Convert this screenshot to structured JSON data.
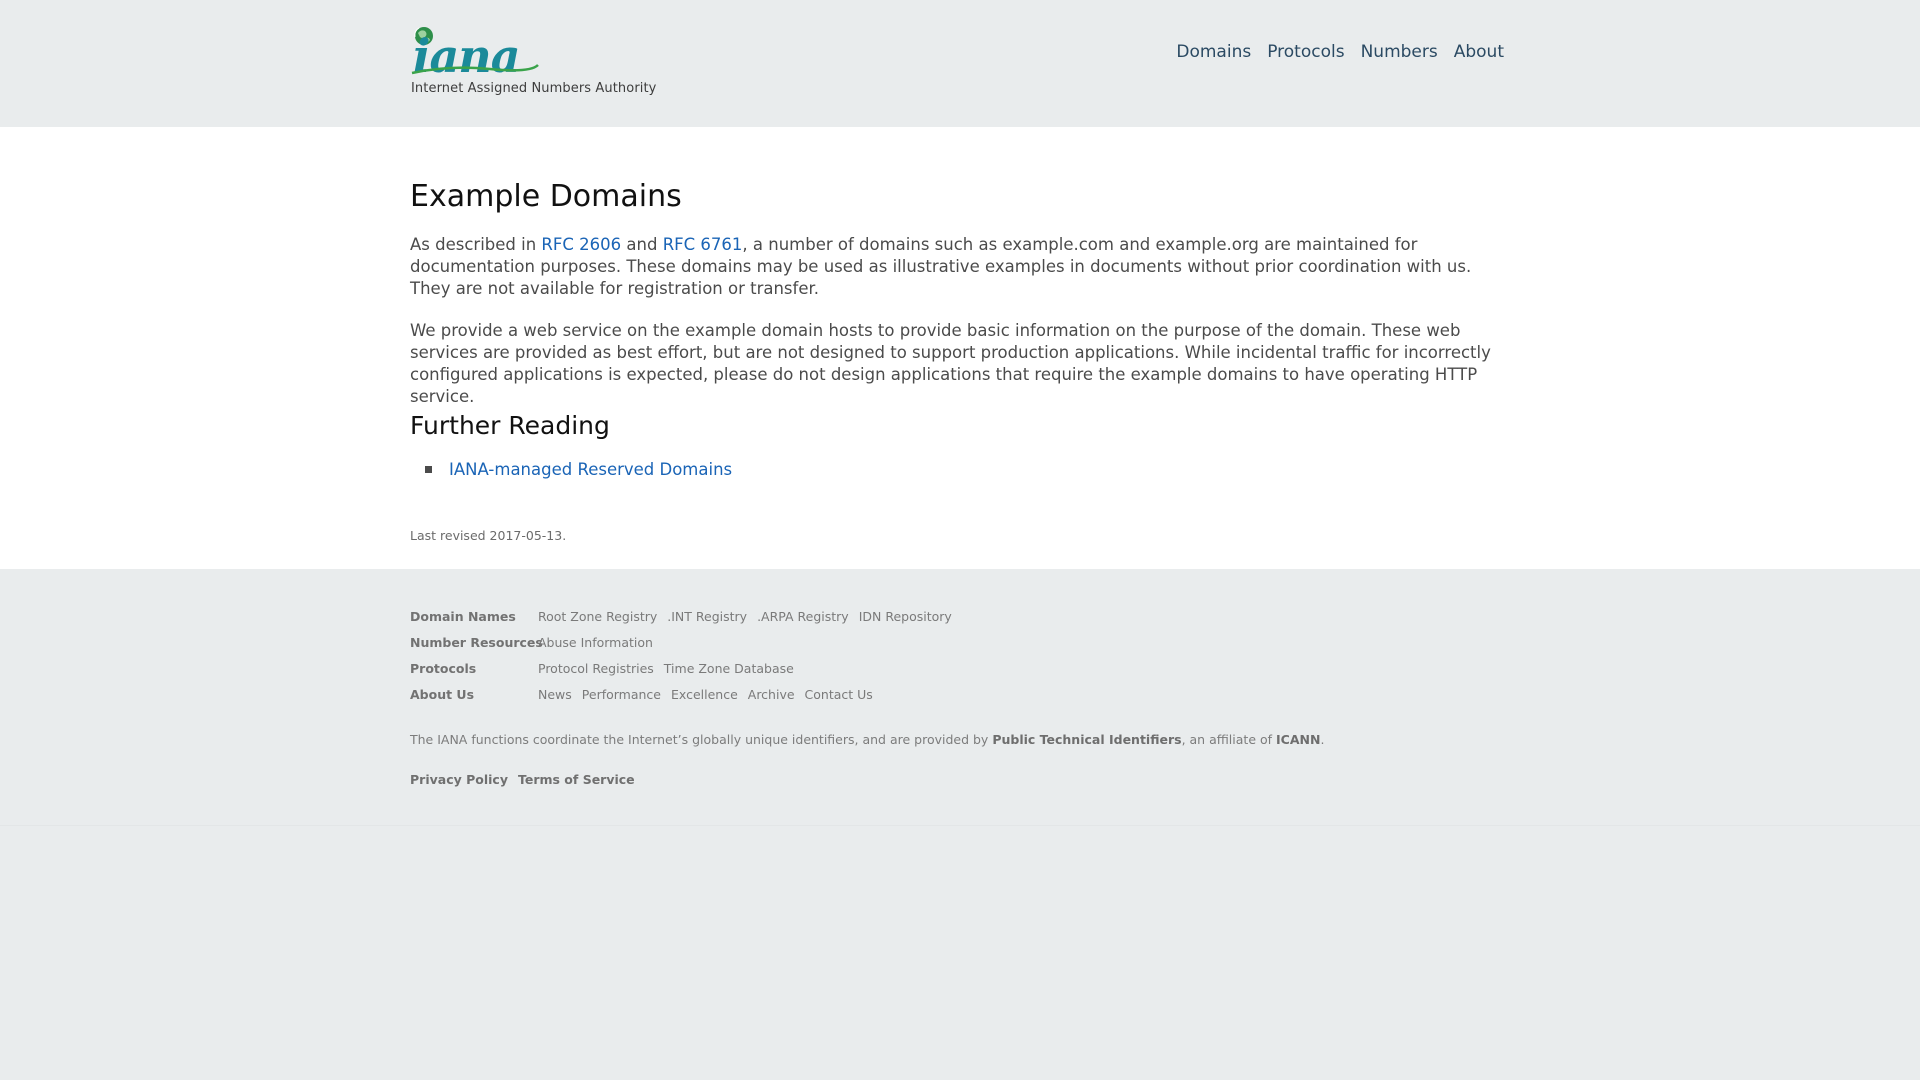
{
  "header": {
    "logo_word": "iana",
    "logo_tagline": "Internet Assigned Numbers Authority",
    "nav": [
      "Domains",
      "Protocols",
      "Numbers",
      "About"
    ]
  },
  "main": {
    "title": "Example Domains",
    "para1": {
      "t1": "As described in ",
      "link1": "RFC 2606",
      "t2": " and ",
      "link2": "RFC 6761",
      "t3": ", a number of domains such as example.com and example.org are maintained for documentation purposes. These domains may be used as illustrative examples in documents without prior coordination with us. They are not available for registration or transfer."
    },
    "para2": "We provide a web service on the example domain hosts to provide basic information on the purpose of the domain. These web services are provided as best effort, but are not designed to support production applications. While incidental traffic for incorrectly configured applications is expected, please do not design applications that require the example domains to have operating HTTP service.",
    "further_reading_title": "Further Reading",
    "further_reading_links": [
      "IANA-managed Reserved Domains"
    ],
    "last_revised": "Last revised 2017-05-13."
  },
  "footer": {
    "rows": [
      {
        "label": "Domain Names",
        "links": [
          "Root Zone Registry",
          ".INT Registry",
          ".ARPA Registry",
          "IDN Repository"
        ]
      },
      {
        "label": "Number Resources",
        "links": [
          "Abuse Information"
        ]
      },
      {
        "label": "Protocols",
        "links": [
          "Protocol Registries",
          "Time Zone Database"
        ]
      },
      {
        "label": "About Us",
        "links": [
          "News",
          "Performance",
          "Excellence",
          "Archive",
          "Contact Us"
        ]
      }
    ],
    "note": {
      "t1": "The IANA functions coordinate the Internet’s globally unique identifiers, and are provided by ",
      "b1": "Public Technical Identifiers",
      "t2": ", an affiliate of ",
      "b2": "ICANN",
      "t3": "."
    },
    "legal_links": [
      "Privacy Policy",
      "Terms of Service"
    ]
  },
  "colors": {
    "background": "#e9eced",
    "content_bg": "#ffffff",
    "link": "#1a64b6",
    "nav_link": "#2b4a63",
    "logo_teal": "#1b8a9a",
    "logo_green": "#3aa34a"
  },
  "icons": {
    "logo_globe": "globe-icon"
  }
}
